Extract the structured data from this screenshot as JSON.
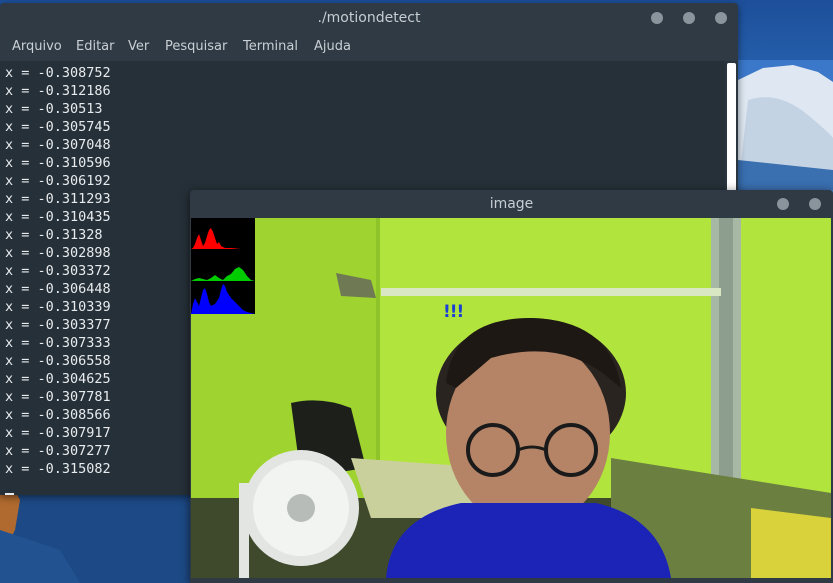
{
  "terminal": {
    "title": "./motiondetect",
    "menu": [
      "Arquivo",
      "Editar",
      "Ver",
      "Pesquisar",
      "Terminal",
      "Ajuda"
    ],
    "lines": [
      "x = -0.308752",
      "x = -0.312186",
      "x = -0.30513",
      "x = -0.305745",
      "x = -0.307048",
      "x = -0.310596",
      "x = -0.306192",
      "x = -0.311293",
      "x = -0.310435",
      "x = -0.31328",
      "x = -0.302898",
      "x = -0.303372",
      "x = -0.306448",
      "x = -0.310339",
      "x = -0.303377",
      "x = -0.307333",
      "x = -0.306558",
      "x = -0.304625",
      "x = -0.307781",
      "x = -0.308566",
      "x = -0.307917",
      "x = -0.307277",
      "x = -0.315082"
    ]
  },
  "image_window": {
    "title": "image",
    "marker": "!!!",
    "histogram_colors": [
      "#ff0000",
      "#00cc00",
      "#0000ff"
    ]
  },
  "colors": {
    "titlebar": "#2f3a44",
    "terminal_bg": "#263038",
    "text": "#e8ecef",
    "wall": "#aee43a",
    "shirt": "#1c24b8"
  }
}
